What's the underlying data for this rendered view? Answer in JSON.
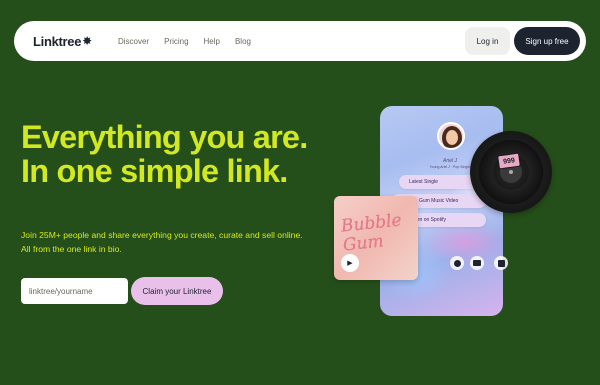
{
  "brand": {
    "name": "Linktree",
    "star": "✸"
  },
  "nav": {
    "links": [
      "Discover",
      "Pricing",
      "Help",
      "Blog"
    ],
    "login_label": "Log in",
    "signup_label": "Sign up free"
  },
  "hero": {
    "headline": "Everything you are. In one simple link.",
    "subtext": "Join 25M+ people and share everything you create, curate and sell online. All from the one link in bio.",
    "input_placeholder": "linktree/yourname",
    "claim_label": "Claim your Linktree"
  },
  "phone": {
    "artist_name": "Ariel J",
    "artist_sub": "Young Ariel J · Pop Singer",
    "links": [
      "Latest Single",
      "Bubble Gum Music Video",
      "Listen on Spotify"
    ],
    "sticker": "999",
    "album_title": "Bubble Gum"
  },
  "colors": {
    "background": "#254f1a",
    "accent": "#d2e823",
    "claim_button": "#e9c0e9",
    "dark": "#1e2330"
  },
  "icons": [
    "play-icon",
    "spotify-icon",
    "youtube-icon",
    "shop-icon"
  ]
}
